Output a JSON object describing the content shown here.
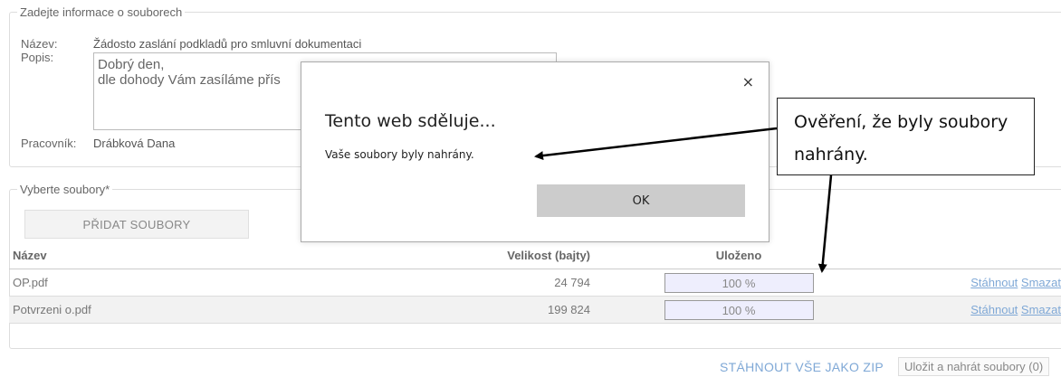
{
  "file_info": {
    "legend": "Zadejte informace o souborech",
    "name_label": "Název:",
    "name_value": "Žádosto zaslání podkladů pro smluvní dokumentaci",
    "desc_label": "Popis:",
    "desc_value": "Dobrý den,\ndle dohody Vám zasíláme přís",
    "worker_label": "Pracovník:",
    "worker_value": "Drábková Dana"
  },
  "files_section": {
    "legend": "Vyberte soubory*",
    "add_button": "PŘIDAT SOUBORY",
    "columns": [
      "Název",
      "Velikost (bajty)",
      "Uloženo"
    ],
    "rows": [
      {
        "name": "OP.pdf",
        "size": "24 794",
        "progress": "100 %",
        "download": "Stáhnout",
        "delete": "Smazat"
      },
      {
        "name": "Potvrzeni o.pdf",
        "size": "199 824",
        "progress": "100 %",
        "download": "Stáhnout",
        "delete": "Smazat"
      }
    ]
  },
  "footer": {
    "zip_label": "STÁHNOUT VŠE JAKO ZIP",
    "save_label": "Uložit a nahrát soubory (0)"
  },
  "dialog": {
    "close": "×",
    "title": "Tento web sděluje...",
    "message": "Vaše soubory byly nahrány.",
    "ok": "OK"
  },
  "callout": {
    "text": "Ověření, že byly soubory nahrány."
  }
}
